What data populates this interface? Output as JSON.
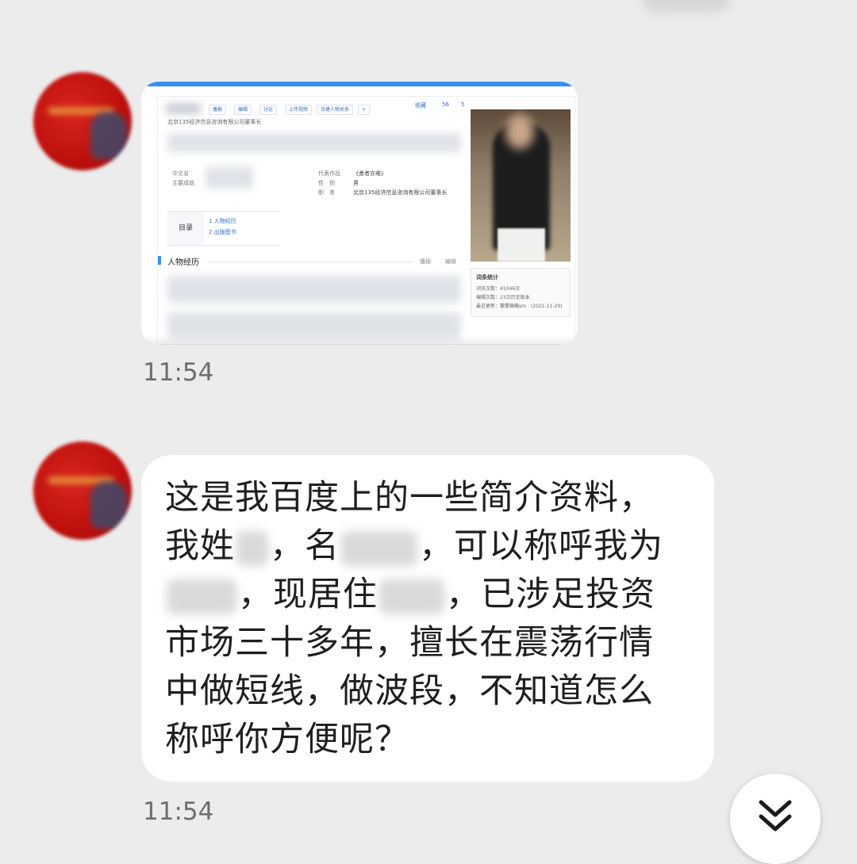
{
  "messages": [
    {
      "type": "image",
      "time": "11:54",
      "screenshot": {
        "toolbar": [
          "播报",
          "编辑",
          "讨论",
          "上传视频",
          "合建人物关系"
        ],
        "top_actions": [
          "收藏",
          "56",
          "5"
        ],
        "subtitle": "北京135经济信息咨询有限公司董事长",
        "info_left": [
          "中文名",
          "主要成就"
        ],
        "info_right": [
          {
            "label": "代表作品",
            "value": "《勇者亦难》"
          },
          {
            "label": "性　别",
            "value": "男"
          },
          {
            "label": "职　务",
            "value": "北京135经济信息咨询有限公司董事长"
          }
        ],
        "toc_title": "目录",
        "toc_items": [
          "1  人物经历",
          "2  出版图书"
        ],
        "section_title": "人物经历",
        "section_actions": [
          "播报",
          "编辑"
        ],
        "stats_title": "词条统计",
        "stats_lines": [
          "浏览次数：41046次",
          "编辑次数：23次历史版本",
          "最近更新：蒙蒙稿稿sm　(2021-11-29)"
        ]
      }
    },
    {
      "type": "text",
      "time": "11:54",
      "parts": [
        "这是我百度上的一些简介资料，\n我姓",
        "，名",
        "，可以称呼我为\n",
        "，现居住",
        "，已涉足投资\n市场三十多年，擅长在震荡行情\n中做短线，做波段，不知道怎么\n称呼你方便呢？"
      ]
    }
  ],
  "scroll_button": {
    "icon": "double-chevron-down-icon"
  },
  "colors": {
    "background": "#ececec",
    "bubble": "#ffffff",
    "accent": "#3b8ef2"
  }
}
